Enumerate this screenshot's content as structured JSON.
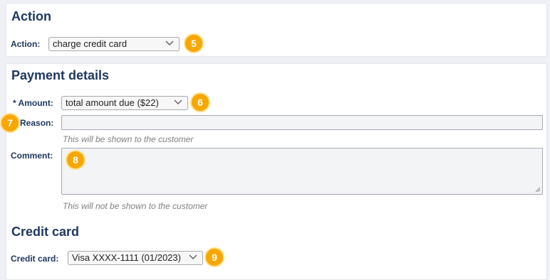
{
  "action_section": {
    "title": "Action",
    "action_label": "Action:",
    "action_value": "charge credit card",
    "badge": "5"
  },
  "payment_section": {
    "title": "Payment details",
    "amount_label": "* Amount:",
    "amount_value": "total amount due ($22)",
    "amount_badge": "6",
    "reason_label": "Reason:",
    "reason_badge": "7",
    "reason_value": "",
    "reason_hint": "This will be shown to the customer",
    "comment_label": "Comment:",
    "comment_badge": "8",
    "comment_value": "",
    "comment_hint": "This will not be shown to the customer"
  },
  "credit_card_section": {
    "title": "Credit card",
    "card_label": "Credit card:",
    "card_value": "Visa XXXX-1111 (01/2023)",
    "badge": "9"
  },
  "colors": {
    "heading": "#1f3760",
    "badge": "#f7a700",
    "hint": "#808080",
    "background": "#eef0f6"
  },
  "icons": {
    "select_arrow": "chevron-down-icon",
    "textarea_resize": "resize-grip-icon"
  }
}
